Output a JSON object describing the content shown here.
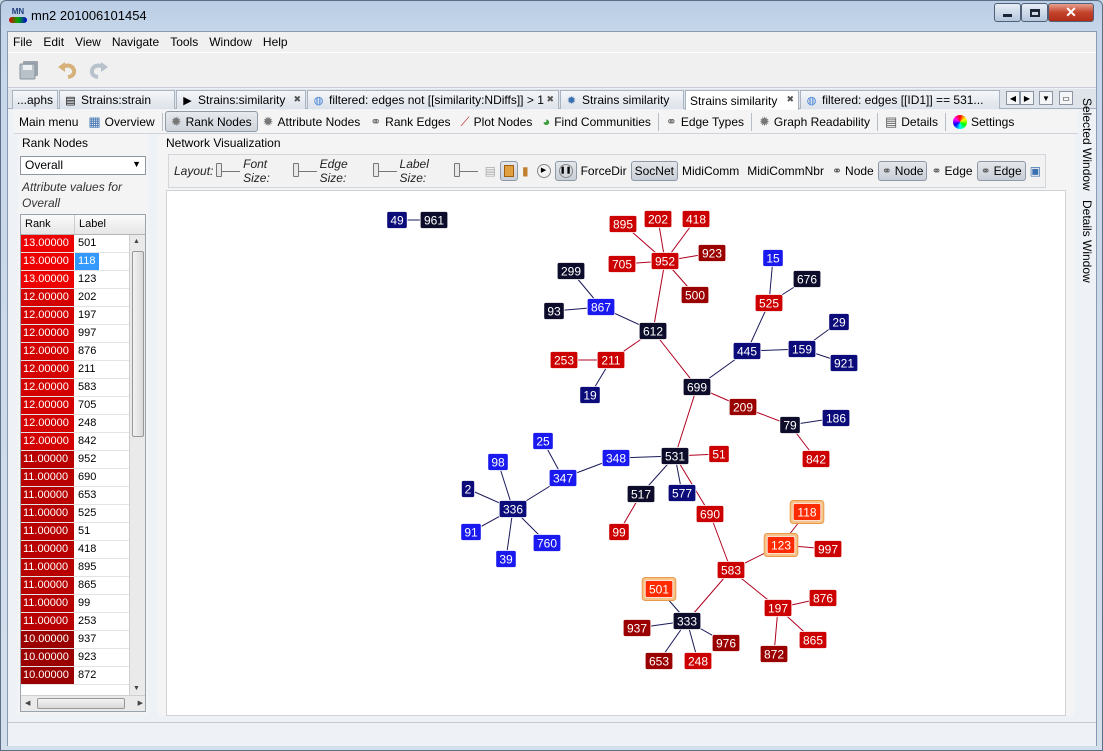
{
  "window": {
    "title": "mn2 201006101454",
    "app_icon": "MN"
  },
  "menu": [
    "File",
    "Edit",
    "View",
    "Navigate",
    "Tools",
    "Window",
    "Help"
  ],
  "doc_tabs": [
    {
      "label": "...aphs",
      "icon": ""
    },
    {
      "label": "Strains:strain",
      "icon": "doc-icon"
    },
    {
      "label": "Strains:similarity",
      "icon": "arrow-doc-icon"
    },
    {
      "label": "filtered: edges not [[similarity:NDiffs]] > 1",
      "icon": "globe-icon"
    },
    {
      "label": "Strains similarity",
      "icon": "gear-icon"
    },
    {
      "label": "Strains similarity",
      "icon": ""
    },
    {
      "label": "filtered: edges  [[ID1]] == 531...",
      "icon": "globe-icon"
    }
  ],
  "sub_toolbar": [
    {
      "label": "Main menu",
      "icon": ""
    },
    {
      "label": "Overview",
      "icon": "overview-icon"
    },
    {
      "label": "Rank Nodes",
      "icon": "gear-icon",
      "pressed": true
    },
    {
      "label": "Attribute Nodes",
      "icon": "gear-icon"
    },
    {
      "label": "Rank Edges",
      "icon": "link-icon"
    },
    {
      "label": "Plot Nodes",
      "icon": "plot-icon"
    },
    {
      "label": "Find Communities",
      "icon": "pie-icon"
    },
    {
      "label": "Edge Types",
      "icon": "link-icon"
    },
    {
      "label": "Graph Readability",
      "icon": "gear-icon"
    },
    {
      "label": "Details",
      "icon": "details-icon"
    },
    {
      "label": "Settings",
      "icon": "color-wheel-icon"
    }
  ],
  "side_tabs": [
    "Selected Window",
    "Details Window"
  ],
  "rank_panel": {
    "title": "Rank Nodes",
    "dropdown_value": "Overall",
    "description": "Attribute values for Overall",
    "col_rank": "Rank",
    "col_label": "Label",
    "rows": [
      {
        "rank": "13.00000",
        "label": "501"
      },
      {
        "rank": "13.00000",
        "label": "118"
      },
      {
        "rank": "13.00000",
        "label": "123"
      },
      {
        "rank": "12.00000",
        "label": "202"
      },
      {
        "rank": "12.00000",
        "label": "197"
      },
      {
        "rank": "12.00000",
        "label": "997"
      },
      {
        "rank": "12.00000",
        "label": "876"
      },
      {
        "rank": "12.00000",
        "label": "211"
      },
      {
        "rank": "12.00000",
        "label": "583"
      },
      {
        "rank": "12.00000",
        "label": "705"
      },
      {
        "rank": "12.00000",
        "label": "248"
      },
      {
        "rank": "12.00000",
        "label": "842"
      },
      {
        "rank": "11.00000",
        "label": "952"
      },
      {
        "rank": "11.00000",
        "label": "690"
      },
      {
        "rank": "11.00000",
        "label": "653"
      },
      {
        "rank": "11.00000",
        "label": "525"
      },
      {
        "rank": "11.00000",
        "label": "51"
      },
      {
        "rank": "11.00000",
        "label": "418"
      },
      {
        "rank": "11.00000",
        "label": "895"
      },
      {
        "rank": "11.00000",
        "label": "865"
      },
      {
        "rank": "11.00000",
        "label": "99"
      },
      {
        "rank": "11.00000",
        "label": "253"
      },
      {
        "rank": "10.00000",
        "label": "937"
      },
      {
        "rank": "10.00000",
        "label": "923"
      },
      {
        "rank": "10.00000",
        "label": "872"
      }
    ],
    "selected_label": "118"
  },
  "network": {
    "title": "Network Visualization",
    "toolbar": {
      "layout_label": "Layout:",
      "font_size_label": "Font Size:",
      "edge_size_label": "Edge Size:",
      "label_size_label": "Label Size:",
      "forcedir": "ForceDir",
      "socnet": "SocNet",
      "midicomm": "MidiComm",
      "midicommnbr": "MidiCommNbr",
      "node1": "Node",
      "node2": "Node",
      "edge1": "Edge",
      "edge2": "Edge"
    },
    "colors": {
      "black": "#0d0d2b",
      "navy": "#0b0b7a",
      "blue": "#1a1af0",
      "red": "#cc0000",
      "darkred": "#9b0000",
      "highlight": "#ff2a00",
      "edge_dark": "#1a1a5a",
      "edge_red": "#b00020"
    }
  }
}
